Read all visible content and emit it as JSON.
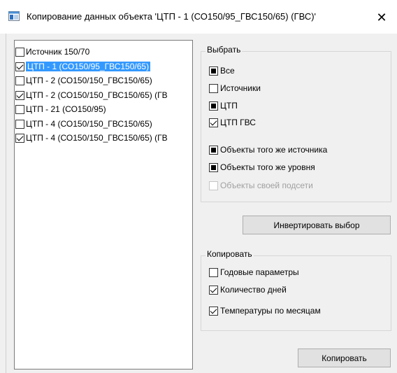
{
  "window": {
    "title": "Копирование данных объекта 'ЦТП - 1 (СО150/95_ГВС150/65) (ГВС)'",
    "close_glyph": "✕"
  },
  "objects_list": [
    {
      "label": "Источник 150/70",
      "state": "unchecked",
      "selected": false
    },
    {
      "label": "ЦТП - 1 (СО150/95_ГВС150/65)",
      "state": "checked",
      "selected": true
    },
    {
      "label": "ЦТП - 2 (СО150/150_ГВС150/65)",
      "state": "unchecked",
      "selected": false
    },
    {
      "label": "ЦТП - 2 (СО150/150_ГВС150/65) (ГВ",
      "state": "checked",
      "selected": false
    },
    {
      "label": "ЦТП - 21 (СО150/95)",
      "state": "unchecked",
      "selected": false
    },
    {
      "label": "ЦТП - 4 (СО150/150_ГВС150/65)",
      "state": "unchecked",
      "selected": false
    },
    {
      "label": "ЦТП - 4 (СО150/150_ГВС150/65) (ГВ",
      "state": "checked",
      "selected": false
    }
  ],
  "select_group": {
    "title": "Выбрать",
    "options": [
      {
        "label": "Все",
        "state": "indeterminate"
      },
      {
        "label": "Источники",
        "state": "unchecked"
      },
      {
        "label": "ЦТП",
        "state": "indeterminate"
      },
      {
        "label": "ЦТП ГВС",
        "state": "checked"
      },
      {
        "label": "Объекты того же источника",
        "state": "indeterminate"
      },
      {
        "label": "Объекты того же уровня",
        "state": "indeterminate"
      },
      {
        "label": "Объекты своей подсети",
        "state": "disabled"
      }
    ]
  },
  "invert_button": "Инвертировать выбор",
  "copy_group": {
    "title": "Копировать",
    "options": [
      {
        "label": "Годовые параметры",
        "state": "unchecked"
      },
      {
        "label": "Количество дней",
        "state": "checked"
      },
      {
        "label": "Температуры по месяцам",
        "state": "checked"
      }
    ]
  },
  "copy_button": "Копировать",
  "colors": {
    "selection": "#3399ff",
    "window_bg": "#f0f0f0"
  }
}
